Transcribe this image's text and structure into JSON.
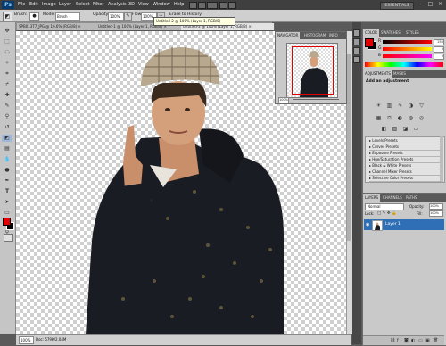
{
  "app": {
    "logo": "Ps",
    "menu": [
      "File",
      "Edit",
      "Image",
      "Layer",
      "Select",
      "Filter",
      "Analysis",
      "3D",
      "View",
      "Window",
      "Help"
    ],
    "workspace": "ESSENTIALS",
    "window_controls": [
      "–",
      "□",
      "×"
    ]
  },
  "options_bar": {
    "brush_label": "Brush:",
    "mode_label": "Mode:",
    "mode_value": "Brush",
    "opacity_label": "Opacity:",
    "opacity_value": "100%",
    "flow_label": "Flow:",
    "flow_value": "100%",
    "erase_to_history_label": "Erase to History",
    "tooltip": "Untitled-2 @ 100% (Layer 1, RGB/8)"
  },
  "document_tabs": [
    {
      "label": "SPB013T7_JPG @ 16.6% (RGB/8) ×",
      "active": false
    },
    {
      "label": "Untitled-1 @ 100% (Layer 1, RGB/8) ×",
      "active": false
    },
    {
      "label": "Untitled-2 @ 100% (Layer 1, RGB/8) ×",
      "active": true
    }
  ],
  "status_bar": {
    "zoom": "100%",
    "doc_size": "Doc: 579K/2.04M"
  },
  "navigator": {
    "tabs": [
      "NAVIGATOR",
      "HISTOGRAM",
      "INFO"
    ],
    "zoom": "100%"
  },
  "color_panel": {
    "tabs": [
      "COLOR",
      "SWATCHES",
      "STYLES"
    ],
    "foreground": "#e00000",
    "background": "#000000",
    "channels": [
      {
        "label": "R",
        "value": "255"
      },
      {
        "label": "G",
        "value": "0"
      },
      {
        "label": "B",
        "value": "0"
      }
    ]
  },
  "adjustments": {
    "tabs": [
      "ADJUSTMENTS",
      "MASKS"
    ],
    "heading": "Add an adjustment",
    "presets": [
      "Levels Presets",
      "Curves Presets",
      "Exposure Presets",
      "Hue/Saturation Presets",
      "Black & White Presets",
      "Channel Mixer Presets",
      "Selective Color Presets"
    ]
  },
  "layers": {
    "tabs": [
      "LAYERS",
      "CHANNELS",
      "PATHS"
    ],
    "blend_mode": "Normal",
    "opacity_label": "Opacity:",
    "opacity_value": "100%",
    "lock_label": "Lock:",
    "fill_label": "Fill:",
    "fill_value": "100%",
    "layer_name": "Layer 1"
  },
  "colors": {
    "app_bg": "#5a5a5a",
    "panel_bg": "#c9c9c9",
    "accent_red": "#e00000",
    "selection_blue": "#2f6fb6"
  }
}
